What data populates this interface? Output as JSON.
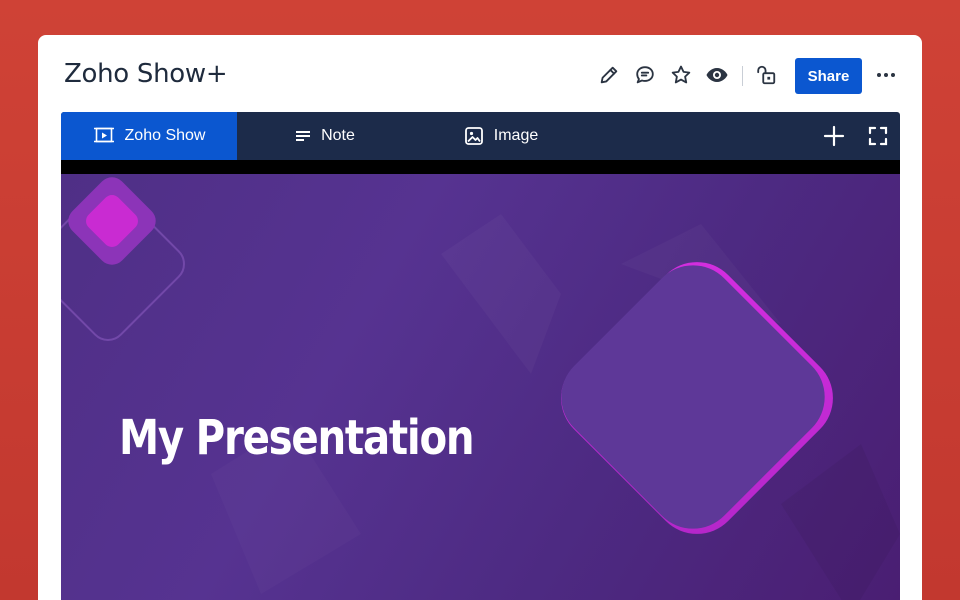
{
  "header": {
    "title": "Zoho Show+",
    "share_label": "Share",
    "icons": [
      "pencil-icon",
      "comment-icon",
      "star-icon",
      "eye-icon",
      "unlock-icon",
      "more-icon"
    ]
  },
  "embed": {
    "tabs": [
      {
        "label": "Zoho Show",
        "icon": "presentation-icon",
        "active": true
      },
      {
        "label": "Note",
        "icon": "note-lines-icon",
        "active": false
      },
      {
        "label": "Image",
        "icon": "image-icon",
        "active": false
      }
    ],
    "actions": [
      "plus-icon",
      "fullscreen-icon"
    ]
  },
  "slide": {
    "title": "My Presentation"
  },
  "colors": {
    "background": "#c93f34",
    "accent": "#0b57d0",
    "toolbar": "#1c2b4a",
    "slide_purple": "#4f2f86",
    "magenta": "#c92bd2"
  }
}
